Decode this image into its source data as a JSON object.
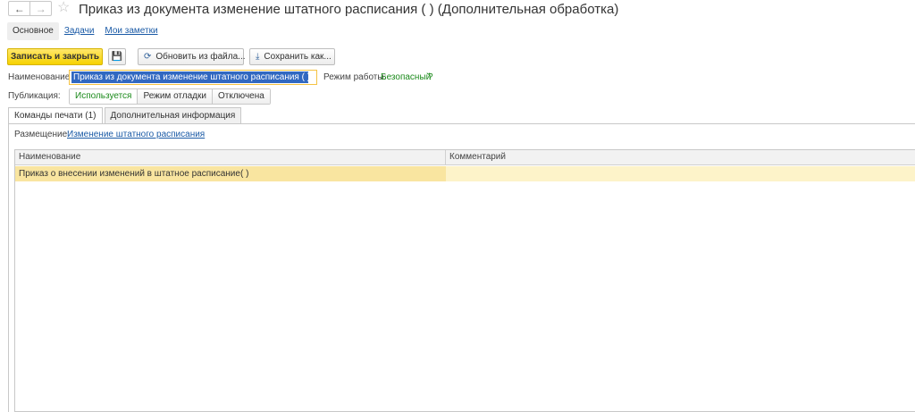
{
  "window": {
    "title": "Приказ из документа изменение штатного расписания (          ) (Дополнительная обработка)",
    "back_icon": "←",
    "forward_icon": "→",
    "star_icon": "☆"
  },
  "top_tabs": [
    {
      "label": "Основное"
    },
    {
      "label": "Задачи"
    },
    {
      "label": "Мои заметки"
    }
  ],
  "toolbar": {
    "save_close_label": "Записать и закрыть",
    "save_icon": "💾",
    "reload_icon": "⟳",
    "reload_label": "Обновить из файла...",
    "saveas_icon": "⤓",
    "saveas_label": "Сохранить как..."
  },
  "form": {
    "name_label": "Наименование:",
    "name_value": "Приказ из документа изменение штатного расписания (          )",
    "mode_label": "Режим работы:",
    "mode_value": "Безопасный",
    "mode_help": "?",
    "publication_label": "Публикация:",
    "publication_options": [
      "Используется",
      "Режим отладки",
      "Отключена"
    ]
  },
  "inner_tabs": [
    {
      "label": "Команды печати (1)"
    },
    {
      "label": "Дополнительная информация"
    }
  ],
  "placement": {
    "label": "Размещение:",
    "link": "Изменение штатного расписания"
  },
  "table": {
    "columns": [
      "Наименование",
      "Комментарий"
    ],
    "rows": [
      {
        "name": "Приказ о внесении изменений в штатное расписание(          )",
        "comment": ""
      }
    ]
  }
}
